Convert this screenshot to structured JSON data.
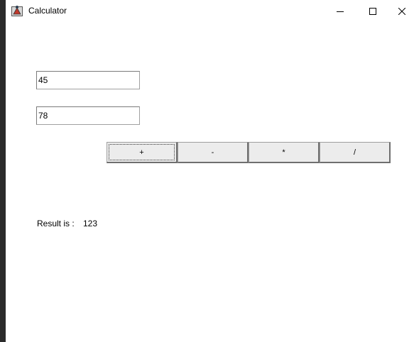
{
  "window": {
    "title": "Calculator",
    "icons": {
      "app": "java-app-icon",
      "minimize": "minimize-icon",
      "maximize": "maximize-icon",
      "close": "close-icon"
    }
  },
  "inputs": {
    "first_value": "45",
    "second_value": "78"
  },
  "operations": [
    {
      "label": "+"
    },
    {
      "label": "-"
    },
    {
      "label": "*"
    },
    {
      "label": "/"
    }
  ],
  "result": {
    "label": "Result is :",
    "value": "123"
  },
  "colors": {
    "window_bg": "#ffffff",
    "desktop_bg": "#2b2b2b",
    "button_bg": "#ececec"
  }
}
